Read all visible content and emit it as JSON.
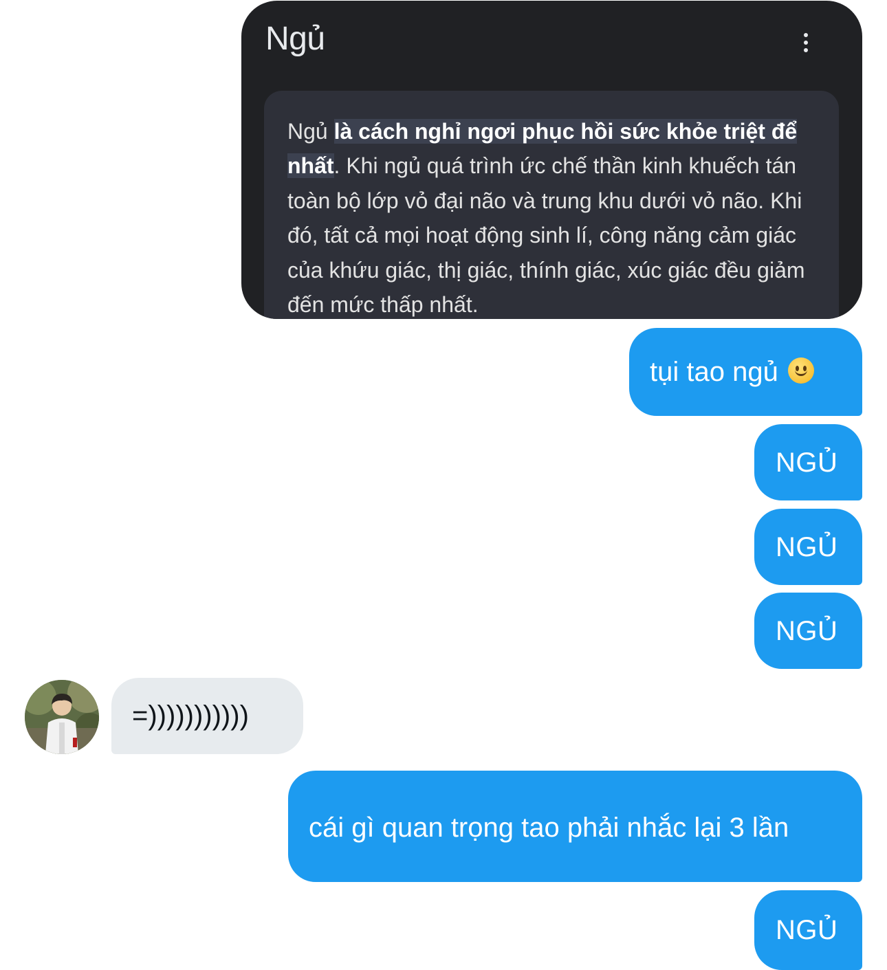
{
  "shared_card": {
    "title": "Ngủ",
    "menu_icon": "more-vert-icon",
    "snippet": {
      "lead": "Ngủ ",
      "highlight": "là cách nghỉ ngơi phục hồi sức khỏe triệt để nhất",
      "rest": ". Khi ngủ quá trình ức chế thần kinh khuếch tán toàn bộ lớp vỏ đại não và trung khu dưới vỏ não. Khi đó, tất cả mọi hoạt động sinh lí, công năng cảm giác của khứu giác, thị giác, thính giác, xúc giác đều giảm đến mức thấp nhất."
    }
  },
  "messages": {
    "m1": {
      "text": "tụi tao ngủ",
      "emoji": "slightly-smiling-face-icon"
    },
    "m2": {
      "text": "NGỦ"
    },
    "m3": {
      "text": "NGỦ"
    },
    "m4": {
      "text": "NGỦ"
    },
    "incoming": {
      "text": "=)))))))))))"
    },
    "m5": {
      "text": "cái gì quan trọng tao phải nhắc lại 3 lần"
    },
    "m6": {
      "text": "NGỦ"
    }
  },
  "colors": {
    "outgoing_bubble": "#1d9bf0",
    "incoming_bubble": "#e7ebee",
    "card_background": "#202124",
    "snippet_background": "#2e3039"
  }
}
